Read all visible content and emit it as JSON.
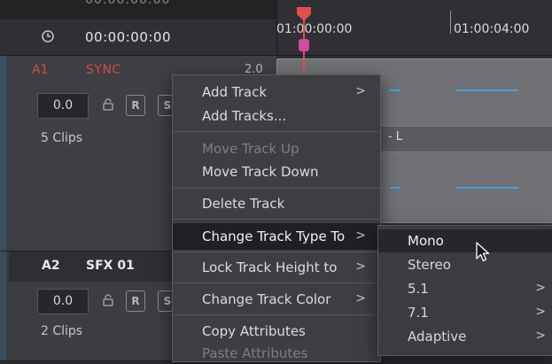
{
  "ruler": {
    "cut_timecode": "00:00:00:00",
    "main_timecode": "00:00:00:00",
    "timecode_1": "01:00:00:00",
    "timecode_2": "01:00:04:00"
  },
  "tracks": [
    {
      "code": "A1",
      "name": "SYNC",
      "format": "2.0",
      "volume": "0.0",
      "record_label": "R",
      "solo_label": "S",
      "clips": "5 Clips"
    },
    {
      "code": "A2",
      "name": "SFX 01",
      "volume": "0.0",
      "record_label": "R",
      "solo_label": "S",
      "clips": "2 Clips"
    }
  ],
  "clip": {
    "label": "- L"
  },
  "context_menu": {
    "items": [
      {
        "label": "Add Track",
        "submenu": true,
        "enabled": true
      },
      {
        "label": "Add Tracks...",
        "submenu": false,
        "enabled": true
      },
      {
        "label": "Move Track Up",
        "submenu": false,
        "enabled": false
      },
      {
        "label": "Move Track Down",
        "submenu": false,
        "enabled": true
      },
      {
        "label": "Delete Track",
        "submenu": false,
        "enabled": true
      },
      {
        "label": "Change Track Type To",
        "submenu": true,
        "enabled": true,
        "highlighted": true
      },
      {
        "label": "Lock Track Height to",
        "submenu": true,
        "enabled": true
      },
      {
        "label": "Change Track Color",
        "submenu": true,
        "enabled": true
      },
      {
        "label": "Copy Attributes",
        "submenu": false,
        "enabled": true
      },
      {
        "label": "Paste Attributes",
        "submenu": false,
        "enabled": false
      }
    ],
    "chevron": ">"
  },
  "submenu": {
    "items": [
      {
        "label": "Mono",
        "submenu": false,
        "highlighted": true
      },
      {
        "label": "Stereo",
        "submenu": false
      },
      {
        "label": "5.1",
        "submenu": true
      },
      {
        "label": "7.1",
        "submenu": true
      },
      {
        "label": "Adaptive",
        "submenu": true
      }
    ]
  },
  "colors": {
    "accent_red": "#d24a45",
    "playhead": "#e05050",
    "marker": "#d24b9c",
    "waveform": "#4aa0d8"
  }
}
